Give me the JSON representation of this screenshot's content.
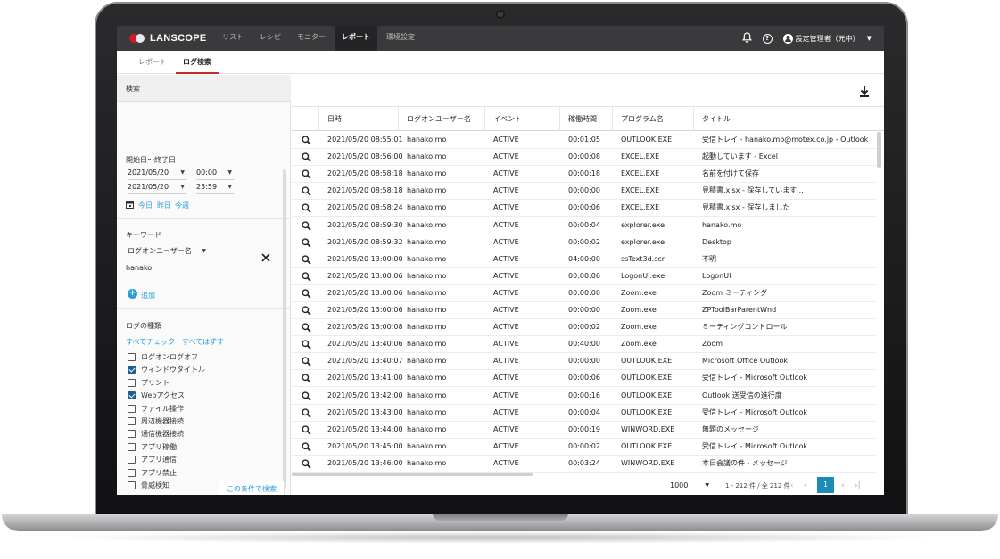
{
  "brand": "LANSCOPE",
  "nav": [
    "リスト",
    "レシピ",
    "モニター",
    "レポート",
    "環境設定"
  ],
  "nav_active": "レポート",
  "user": "設定管理者（元中）",
  "subtabs": [
    "レポート",
    "ログ検索"
  ],
  "subtab_active": "ログ検索",
  "left": {
    "header": "検索",
    "date_label": "開始日〜終了日",
    "start_date": "2021/05/20",
    "start_time": "00:00",
    "end_date": "2021/05/20",
    "end_time": "23:59",
    "quick_today": "今日",
    "quick_yesterday": "昨日",
    "quick_week": "今週",
    "keyword_label": "キーワード",
    "keyword_field": "ログオンユーザー名",
    "keyword_value": "hanako",
    "add_label": "追加",
    "logtype_label": "ログの種類",
    "check_all": "すべてチェック",
    "uncheck_all": "すべてはずす",
    "log_types": [
      {
        "label": "ログオンログオフ",
        "checked": false
      },
      {
        "label": "ウィンドウタイトル",
        "checked": true
      },
      {
        "label": "プリント",
        "checked": false
      },
      {
        "label": "Webアクセス",
        "checked": true
      },
      {
        "label": "ファイル操作",
        "checked": false
      },
      {
        "label": "周辺機器接続",
        "checked": false
      },
      {
        "label": "通信機器接続",
        "checked": false
      },
      {
        "label": "アプリ稼働",
        "checked": false
      },
      {
        "label": "アプリ通信",
        "checked": false
      },
      {
        "label": "アプリ禁止",
        "checked": false
      },
      {
        "label": "脅威検知",
        "checked": false
      }
    ],
    "search_button": "この条件で検索"
  },
  "table": {
    "columns": [
      "日時",
      "ログオンユーザー名",
      "イベント",
      "稼働時間",
      "プログラム名",
      "タイトル"
    ],
    "rows": [
      [
        "2021/05/20 08:55:01",
        "hanako.mo",
        "ACTIVE",
        "00:01:05",
        "OUTLOOK.EXE",
        "受信トレイ - hanako.mo@motex.co.jp - Outlook"
      ],
      [
        "2021/05/20 08:56:00",
        "hanako.mo",
        "ACTIVE",
        "00:00:08",
        "EXCEL.EXE",
        "起動しています - Excel"
      ],
      [
        "2021/05/20 08:58:18",
        "hanako.mo",
        "ACTIVE",
        "00:00:18",
        "EXCEL.EXE",
        "名前を付けて保存"
      ],
      [
        "2021/05/20 08:58:18",
        "hanako.mo",
        "ACTIVE",
        "00:00:00",
        "EXCEL.EXE",
        "見積書.xlsx - 保存しています..."
      ],
      [
        "2021/05/20 08:58:24",
        "hanako.mo",
        "ACTIVE",
        "00:00:06",
        "EXCEL.EXE",
        "見積書.xlsx - 保存しました"
      ],
      [
        "2021/05/20 08:59:30",
        "hanako.mo",
        "ACTIVE",
        "00:00:04",
        "explorer.exe",
        "hanako.mo"
      ],
      [
        "2021/05/20 08:59:32",
        "hanako.mo",
        "ACTIVE",
        "00:00:02",
        "explorer.exe",
        "Desktop"
      ],
      [
        "2021/05/20 13:00:00",
        "hanako.mo",
        "ACTIVE",
        "04:00:00",
        "ssText3d.scr",
        "不明"
      ],
      [
        "2021/05/20 13:00:06",
        "hanako.mo",
        "ACTIVE",
        "00:00:06",
        "LogonUI.exe",
        "LogonUI"
      ],
      [
        "2021/05/20 13:00:06",
        "hanako.mo",
        "ACTIVE",
        "00:00:00",
        "Zoom.exe",
        "Zoom ミーティング"
      ],
      [
        "2021/05/20 13:00:06",
        "hanako.mo",
        "ACTIVE",
        "00:00:00",
        "Zoom.exe",
        "ZPToolBarParentWnd"
      ],
      [
        "2021/05/20 13:00:08",
        "hanako.mo",
        "ACTIVE",
        "00:00:02",
        "Zoom.exe",
        "ミーティングコントロール"
      ],
      [
        "2021/05/20 13:40:06",
        "hanako.mo",
        "ACTIVE",
        "00:40:00",
        "Zoom.exe",
        "Zoom"
      ],
      [
        "2021/05/20 13:40:07",
        "hanako.mo",
        "ACTIVE",
        "00:00:00",
        "OUTLOOK.EXE",
        "Microsoft Office Outlook"
      ],
      [
        "2021/05/20 13:41:00",
        "hanako.mo",
        "ACTIVE",
        "00:00:06",
        "OUTLOOK.EXE",
        "受信トレイ - Microsoft Outlook"
      ],
      [
        "2021/05/20 13:42:00",
        "hanako.mo",
        "ACTIVE",
        "00:00:16",
        "OUTLOOK.EXE",
        "Outlook 送受信の進行度"
      ],
      [
        "2021/05/20 13:43:00",
        "hanako.mo",
        "ACTIVE",
        "00:00:04",
        "OUTLOOK.EXE",
        "受信トレイ - Microsoft Outlook"
      ],
      [
        "2021/05/20 13:44:00",
        "hanako.mo",
        "ACTIVE",
        "00:00:19",
        "WINWORD.EXE",
        "無題のメッセージ"
      ],
      [
        "2021/05/20 13:45:00",
        "hanako.mo",
        "ACTIVE",
        "00:00:02",
        "OUTLOOK.EXE",
        "受信トレイ - Microsoft Outlook"
      ],
      [
        "2021/05/20 13:46:00",
        "hanako.mo",
        "ACTIVE",
        "00:03:24",
        "WINWORD.EXE",
        "本日会議の件 - メッセージ"
      ]
    ]
  },
  "pagination": {
    "page_size": "1000",
    "info": "1 - 212 件 / 全 212 件",
    "current_page": "1"
  },
  "icons": {
    "bell": "bell-icon",
    "help": "help-icon",
    "user": "user-icon",
    "download": "download-icon",
    "search": "magnifier-icon",
    "calendar": "calendar-icon",
    "close": "close-icon",
    "add": "plus-circle-icon"
  },
  "colors": {
    "topbar": "#3a3a3c",
    "accent_red": "#c62b2b",
    "link_blue": "#2a9fd6",
    "check_blue": "#1b5f94",
    "page_active": "#1b8bb8"
  }
}
